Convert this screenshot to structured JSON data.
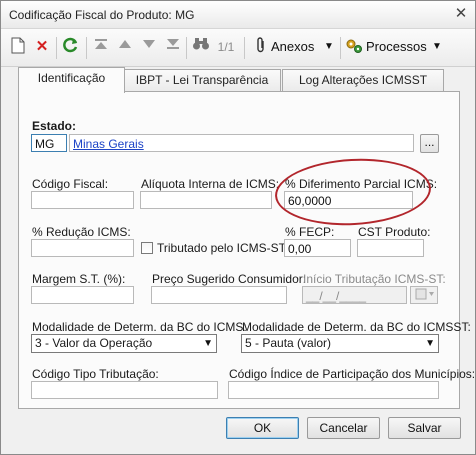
{
  "window": {
    "title": "Codificação Fiscal do Produto: MG",
    "close_glyph": "✕"
  },
  "toolbar": {
    "page_indicator": "1/1",
    "anexos_label": "Anexos",
    "processos_label": "Processos",
    "dropdown_glyph": "▼"
  },
  "tabs": [
    {
      "label": "Identificação",
      "active": true
    },
    {
      "label": "IBPT - Lei Transparência",
      "active": false
    },
    {
      "label": "Log Alterações ICMSST",
      "active": false
    }
  ],
  "form": {
    "estado": {
      "label": "Estado:",
      "value": "MG",
      "name_link": "Minas Gerais",
      "lookup_label": "..."
    },
    "codigo_fiscal": {
      "label": "Código Fiscal:",
      "value": ""
    },
    "aliquota_icms": {
      "label": "Alíquota Interna de ICMS:",
      "value": ""
    },
    "diferimento": {
      "label": "% Diferimento Parcial ICMS:",
      "value": "60,0000"
    },
    "reducao_icms": {
      "label": "% Redução ICMS:",
      "value": ""
    },
    "tributado_st": {
      "label": "Tributado pelo ICMS-ST",
      "checked": false
    },
    "fecp": {
      "label": "% FECP:",
      "value": "0,00"
    },
    "cst_produto": {
      "label": "CST Produto:",
      "value": ""
    },
    "margem_st": {
      "label": "Margem S.T. (%):",
      "value": ""
    },
    "preco_sugerido": {
      "label": "Preço Sugerido Consumidor:",
      "value": ""
    },
    "inicio_tributacao": {
      "label": "Início Tributação ICMS-ST:",
      "value": "__/__/____"
    },
    "modalidade_icms": {
      "label": "Modalidade de Determ. da BC do ICMS:",
      "value": "3 - Valor da Operação"
    },
    "modalidade_icmsst": {
      "label": "Modalidade de Determ. da BC do ICMSST:",
      "value": "5 - Pauta (valor)"
    },
    "codigo_tipo_tributacao": {
      "label": "Código Tipo Tributação:",
      "value": ""
    },
    "codigo_indice": {
      "label": "Código Índice de Participação dos Municípios:",
      "value": ""
    }
  },
  "buttons": {
    "ok": "OK",
    "cancel": "Cancelar",
    "save": "Salvar"
  },
  "colors": {
    "highlight_ellipse": "#b2262c",
    "link": "#1d44c7",
    "accent_border": "#3c7fb1"
  }
}
